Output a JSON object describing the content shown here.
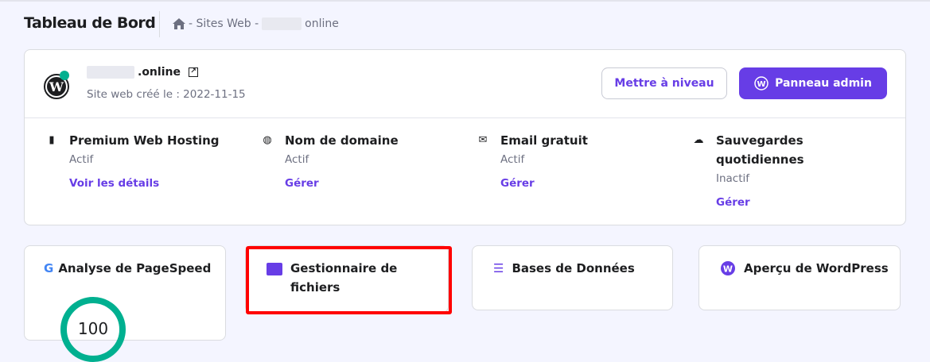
{
  "header": {
    "title": "Tableau de Bord",
    "breadcrumb": [
      " - Sites Web - ",
      "online"
    ]
  },
  "site": {
    "domain": ".online",
    "created": "Site web créé le : 2022-11-15",
    "status_color": "#00b090"
  },
  "buttons": {
    "upgrade": "Mettre à niveau",
    "admin": "Panneau admin"
  },
  "services": [
    {
      "title": "Premium Web Hosting",
      "status": "Actif",
      "link": "Voir les détails"
    },
    {
      "title": "Nom de domaine",
      "status": "Actif",
      "link": "Gérer"
    },
    {
      "title": "Email gratuit",
      "status": "Actif",
      "link": "Gérer"
    },
    {
      "title": "Sauvegardes quotidiennes",
      "status": "Inactif",
      "link": "Gérer"
    }
  ],
  "tiles": {
    "pagespeed": "Analyse de PageSpeed",
    "pagespeed_score": "100",
    "files": "Gestionnaire de fichiers",
    "db": "Bases de Données",
    "wp": "Aperçu de WordPress"
  },
  "colors": {
    "accent": "#673de6",
    "green": "#00b090"
  }
}
